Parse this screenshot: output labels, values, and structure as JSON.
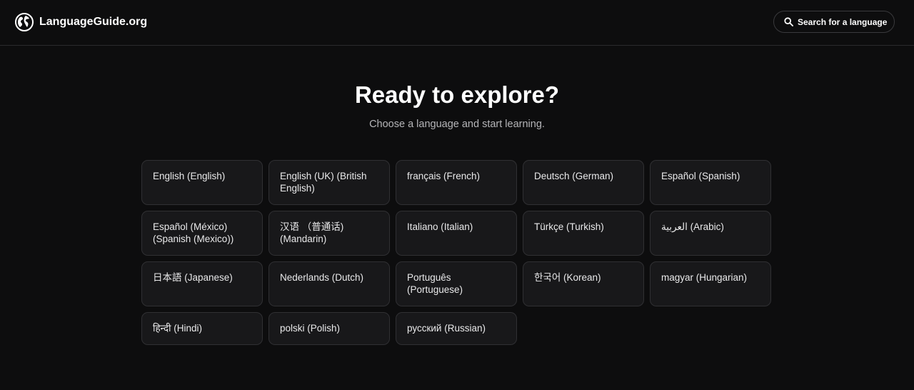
{
  "header": {
    "brand": "LanguageGuide.org",
    "logo_icon": "globe-icon",
    "search_label": "Search for a language",
    "search_icon": "search-icon"
  },
  "hero": {
    "title": "Ready to explore?",
    "subtitle": "Choose a language and start learning."
  },
  "languages": [
    "English (English)",
    "English (UK) (British English)",
    "français (French)",
    "Deutsch (German)",
    "Español (Spanish)",
    "Español (México) (Spanish (Mexico))",
    "汉语 （普通话) (Mandarin)",
    "Italiano (Italian)",
    "Türkçe (Turkish)",
    "العربية (Arabic)",
    "日本語 (Japanese)",
    "Nederlands (Dutch)",
    "Português (Portuguese)",
    "한국어 (Korean)",
    "magyar (Hungarian)",
    "हिन्दी (Hindi)",
    "polski (Polish)",
    "русский (Russian)"
  ],
  "colors": {
    "background": "#0d0d0e",
    "card_background": "#18181a",
    "card_border": "#303033",
    "subtitle": "#b5b5b8"
  }
}
